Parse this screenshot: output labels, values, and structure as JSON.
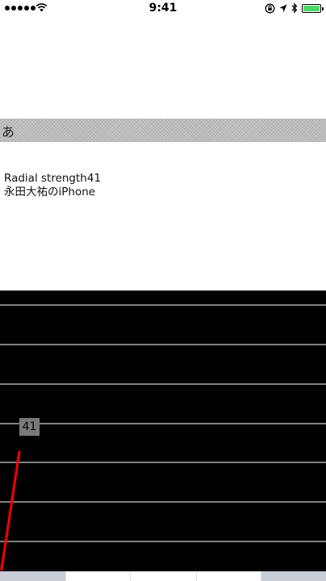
{
  "status_bar": {
    "time": "9:41",
    "signal_dots": 5,
    "battery_color": "#4cd964",
    "icons": [
      "signal-icon",
      "wifi-icon",
      "orientation-lock-icon",
      "location-icon",
      "bluetooth-icon",
      "battery-icon"
    ]
  },
  "input": {
    "value": "あ"
  },
  "info": {
    "strength_text": "Radial strength41",
    "device_name": "永田大祐のiPhone"
  },
  "graph": {
    "value_label": "41",
    "background": "#000000",
    "line_color": "#ff0000",
    "grid_color": "#ffffff",
    "gridlines": 7
  }
}
